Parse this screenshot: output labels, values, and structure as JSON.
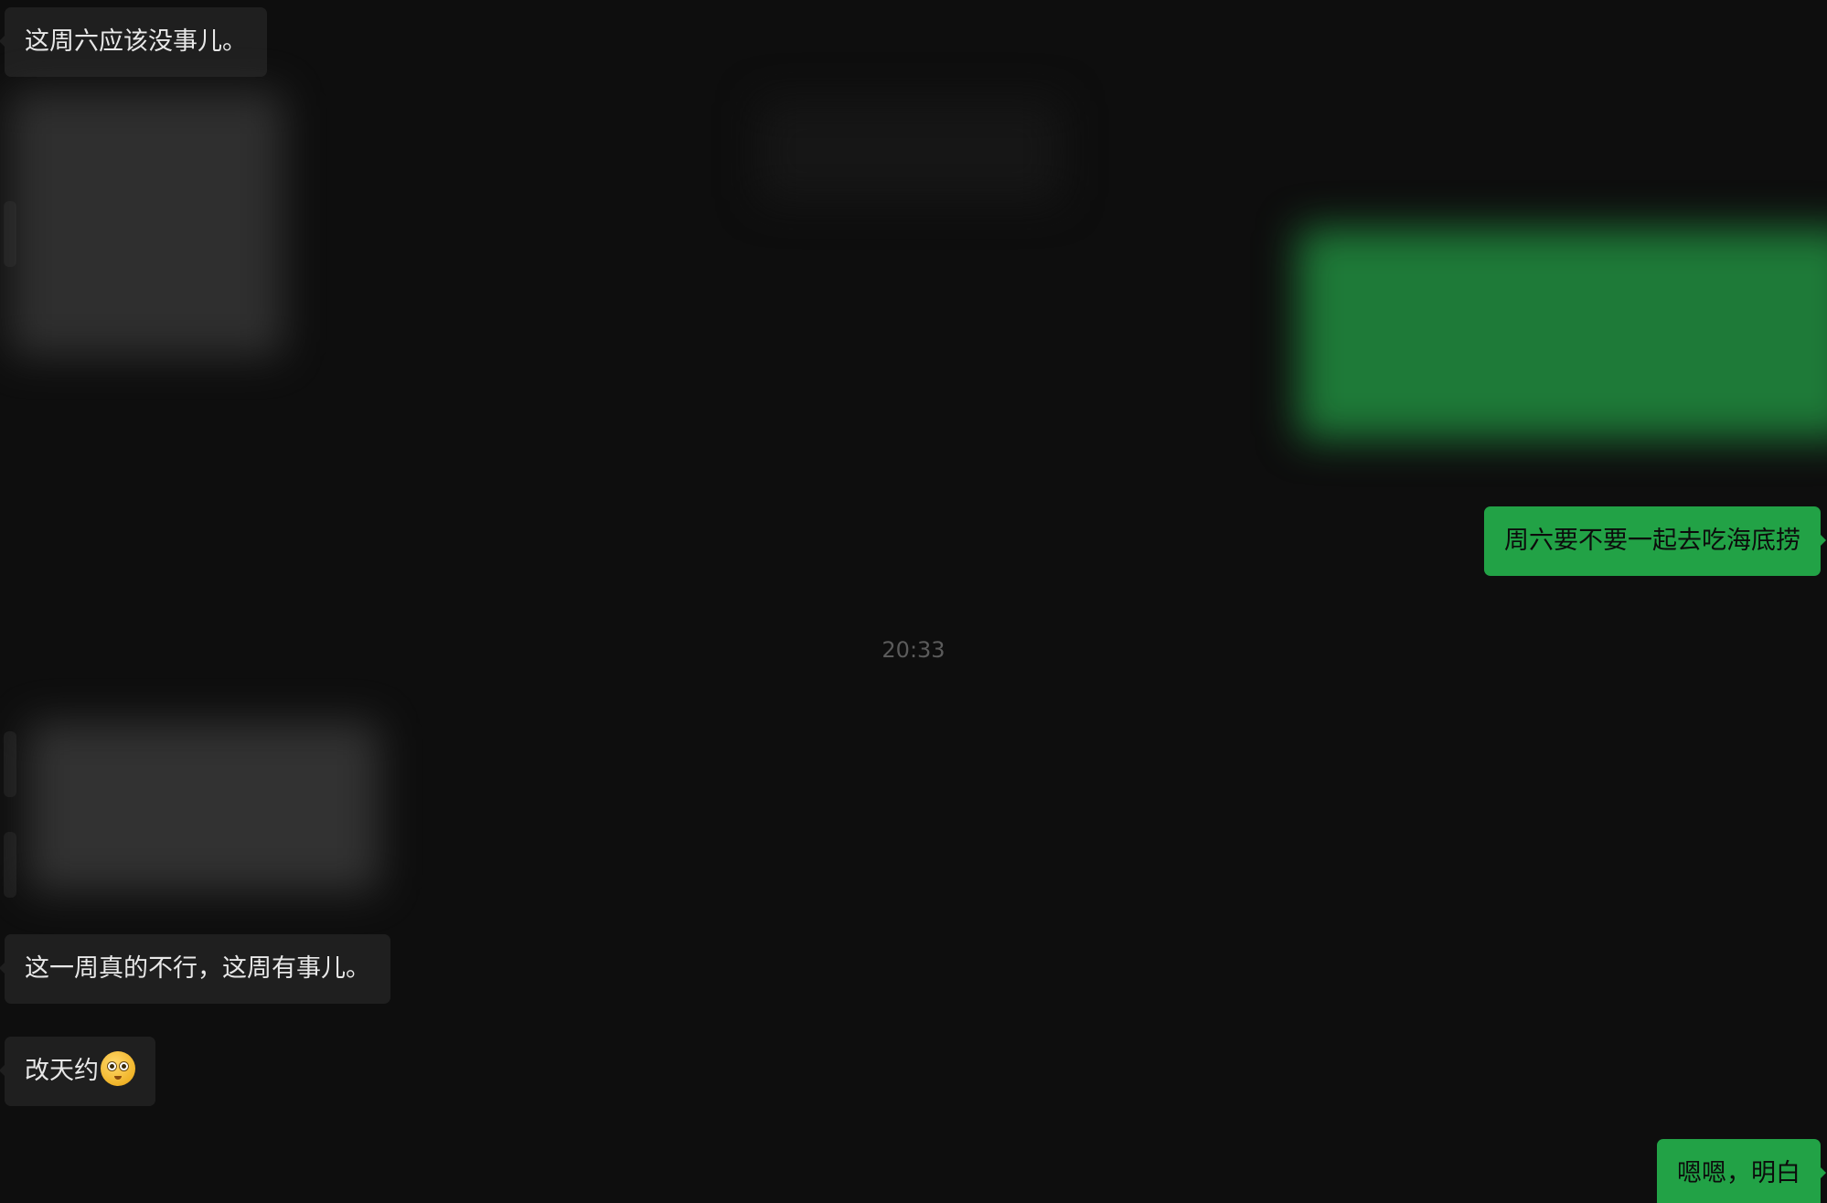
{
  "timestamp": "20:33",
  "messages": {
    "m1": "这周六应该没事儿。",
    "m2": "周六要不要一起去吃海底捞",
    "m3": "这一周真的不行，这周有事儿。",
    "m4": "改天约",
    "m5": "嗯嗯，明白"
  },
  "emoji": "face-with-monocle-icon",
  "colors": {
    "background": "#0e0e0e",
    "incoming_bubble": "#1f1f1f",
    "outgoing_bubble": "#22a246",
    "timestamp_text": "#5b5b5b"
  }
}
